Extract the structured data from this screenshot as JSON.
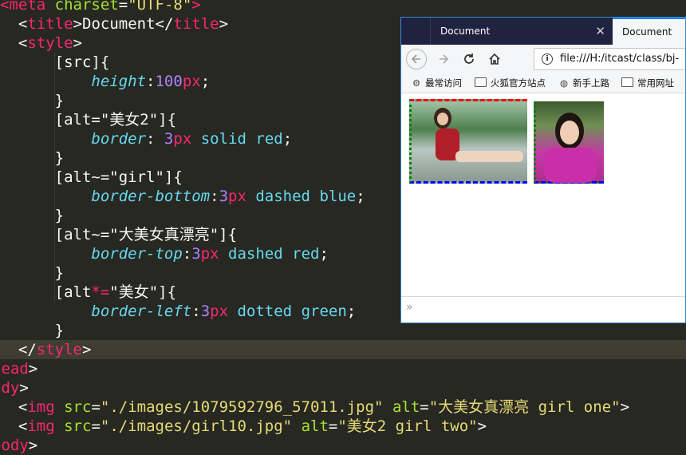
{
  "editor": {
    "lines": [
      {
        "parts": [
          [
            "t",
            "<"
          ],
          [
            "t",
            "meta"
          ],
          [
            "p",
            " "
          ],
          [
            "a",
            "charset"
          ],
          [
            "p",
            "="
          ],
          [
            "s",
            "\"UTF-8\""
          ],
          [
            "t",
            ">"
          ]
        ]
      },
      {
        "parts": [
          [
            "p",
            "  "
          ],
          [
            "p",
            "<"
          ],
          [
            "t",
            "title"
          ],
          [
            "p",
            ">"
          ],
          [
            "p",
            "Document"
          ],
          [
            "p",
            "</"
          ],
          [
            "t",
            "title"
          ],
          [
            "p",
            ">"
          ]
        ]
      },
      {
        "parts": [
          [
            "p",
            "  "
          ],
          [
            "p",
            "<"
          ],
          [
            "t",
            "style"
          ],
          [
            "p",
            ">"
          ]
        ]
      },
      {
        "parts": [
          [
            "p",
            "      "
          ],
          [
            "p",
            "[src]{"
          ]
        ]
      },
      {
        "parts": [
          [
            "p",
            "          "
          ],
          [
            "k",
            "height"
          ],
          [
            "p",
            ":"
          ],
          [
            "n",
            "100"
          ],
          [
            "t",
            "px"
          ],
          [
            "p",
            ";"
          ]
        ]
      },
      {
        "parts": [
          [
            "p",
            "      "
          ],
          [
            "p",
            "}"
          ]
        ]
      },
      {
        "parts": [
          [
            "p",
            "      "
          ],
          [
            "p",
            "[alt=\"美女2\"]{"
          ]
        ]
      },
      {
        "parts": [
          [
            "p",
            "          "
          ],
          [
            "k",
            "border"
          ],
          [
            "p",
            ": "
          ],
          [
            "n",
            "3"
          ],
          [
            "t",
            "px"
          ],
          [
            "p",
            " "
          ],
          [
            "v",
            "solid"
          ],
          [
            "p",
            " "
          ],
          [
            "v",
            "red"
          ],
          [
            "p",
            ";"
          ]
        ]
      },
      {
        "parts": [
          [
            "p",
            "      "
          ],
          [
            "p",
            "}"
          ]
        ]
      },
      {
        "parts": [
          [
            "p",
            "      "
          ],
          [
            "p",
            "[alt~=\"girl\"]{"
          ]
        ]
      },
      {
        "parts": [
          [
            "p",
            "          "
          ],
          [
            "k",
            "border-bottom"
          ],
          [
            "p",
            ":"
          ],
          [
            "n",
            "3"
          ],
          [
            "t",
            "px"
          ],
          [
            "p",
            " "
          ],
          [
            "v",
            "dashed"
          ],
          [
            "p",
            " "
          ],
          [
            "v",
            "blue"
          ],
          [
            "p",
            ";"
          ]
        ]
      },
      {
        "parts": [
          [
            "p",
            "      "
          ],
          [
            "p",
            "}"
          ]
        ]
      },
      {
        "parts": [
          [
            "p",
            "      "
          ],
          [
            "p",
            "[alt~=\"大美女真漂亮\"]{"
          ]
        ]
      },
      {
        "parts": [
          [
            "p",
            "          "
          ],
          [
            "k",
            "border-top"
          ],
          [
            "p",
            ":"
          ],
          [
            "n",
            "3"
          ],
          [
            "t",
            "px"
          ],
          [
            "p",
            " "
          ],
          [
            "v",
            "dashed"
          ],
          [
            "p",
            " "
          ],
          [
            "v",
            "red"
          ],
          [
            "p",
            ";"
          ]
        ]
      },
      {
        "parts": [
          [
            "p",
            "      "
          ],
          [
            "p",
            "}"
          ]
        ]
      },
      {
        "parts": [
          [
            "p",
            "      "
          ],
          [
            "p",
            "[alt"
          ],
          [
            "t",
            "*="
          ],
          [
            "p",
            "\"美女\"]{"
          ]
        ]
      },
      {
        "parts": [
          [
            "p",
            "          "
          ],
          [
            "k",
            "border-left"
          ],
          [
            "p",
            ":"
          ],
          [
            "n",
            "3"
          ],
          [
            "t",
            "px"
          ],
          [
            "p",
            " "
          ],
          [
            "v",
            "dotted"
          ],
          [
            "p",
            " "
          ],
          [
            "v",
            "green"
          ],
          [
            "p",
            ";"
          ]
        ]
      },
      {
        "parts": [
          [
            "p",
            "      "
          ],
          [
            "p",
            "}"
          ]
        ]
      },
      {
        "parts": [
          [
            "p",
            "  "
          ],
          [
            "p",
            "</"
          ],
          [
            "t",
            "style"
          ],
          [
            "p",
            ">"
          ]
        ]
      },
      {
        "parts": [
          [
            "t",
            "head"
          ],
          [
            "p",
            ">"
          ]
        ]
      },
      {
        "parts": [
          [
            "t",
            "ody"
          ],
          [
            "p",
            ">"
          ]
        ]
      },
      {
        "parts": [
          [
            "p",
            "  <"
          ],
          [
            "t",
            "img"
          ],
          [
            "p",
            " "
          ],
          [
            "a",
            "src"
          ],
          [
            "p",
            "="
          ],
          [
            "s",
            "\"./images/1079592796_57011.jpg\""
          ],
          [
            "p",
            " "
          ],
          [
            "a",
            "alt"
          ],
          [
            "p",
            "="
          ],
          [
            "s",
            "\"大美女真漂亮 girl one\""
          ],
          [
            "p",
            ">"
          ]
        ]
      },
      {
        "parts": [
          [
            "p",
            "  <"
          ],
          [
            "t",
            "img"
          ],
          [
            "p",
            " "
          ],
          [
            "a",
            "src"
          ],
          [
            "p",
            "="
          ],
          [
            "s",
            "\"./images/girl10.jpg\""
          ],
          [
            "p",
            " "
          ],
          [
            "a",
            "alt"
          ],
          [
            "p",
            "="
          ],
          [
            "s",
            "\"美女2 girl two\""
          ],
          [
            "p",
            ">"
          ]
        ]
      },
      {
        "parts": [
          [
            "t",
            "body"
          ],
          [
            "p",
            ">"
          ]
        ]
      }
    ],
    "highlighted_line": 18
  },
  "browser": {
    "tabs": [
      {
        "label": "Document"
      },
      {
        "label": "Document"
      }
    ],
    "close_glyph": "✕",
    "url": "file:///H:/itcast/class/bj-",
    "bookmarks": [
      {
        "label": "最常访问",
        "icon": "gear-icon"
      },
      {
        "label": "火狐官方站点",
        "icon": "folder-icon"
      },
      {
        "label": "新手上路",
        "icon": "globe-icon"
      },
      {
        "label": "常用网址",
        "icon": "folder-icon"
      }
    ],
    "images": [
      {
        "alt": "大美女真漂亮 girl one"
      },
      {
        "alt": "美女2 girl two"
      }
    ],
    "status_glyph": "»"
  }
}
